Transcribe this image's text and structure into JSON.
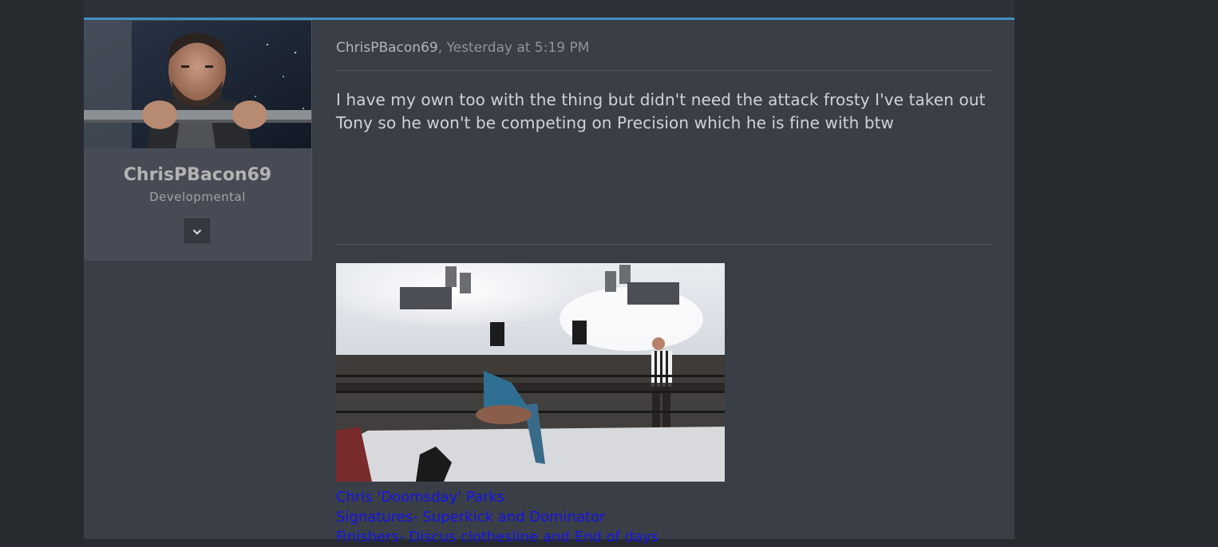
{
  "post": {
    "author": "ChrisPBacon69",
    "separator": ", ",
    "timestamp": "Yesterday at 5:19 PM",
    "message": "I have my own too with the thing but didn't need the attack frosty I've taken out Tony so he won't be competing on Precision which he is fine with btw"
  },
  "user": {
    "name": "ChrisPBacon69",
    "title": "Developmental",
    "expand_icon": "chevron-down-icon"
  },
  "signature": {
    "image_description_icon": "wrestling-ring-photo",
    "lines": [
      "Chris 'Doomsday' Parks",
      "Signatures- Superkick and Dominator",
      "Finishers- Discus clothesline and End of days"
    ]
  },
  "colors": {
    "accent": "#3f8fc4",
    "link": "#1414e6",
    "panel": "#3a3f47",
    "page": "#272b30"
  }
}
